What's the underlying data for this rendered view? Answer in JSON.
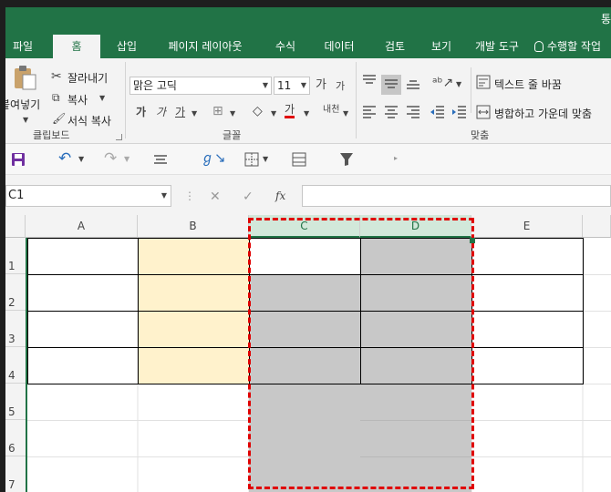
{
  "title": "통",
  "tabs": [
    "파일",
    "홈",
    "삽입",
    "페이지 레이아웃",
    "수식",
    "데이터",
    "검토",
    "보기",
    "개발 도구"
  ],
  "active_tab": "홈",
  "tell_me": "수행할 작업",
  "ribbon": {
    "clipboard": {
      "paste": "붙여넣기",
      "cut": "잘라내기",
      "copy": "복사",
      "format_painter": "서식 복사",
      "group": "클립보드"
    },
    "font": {
      "name": "맑은 고딕",
      "size": "11",
      "grow": "가",
      "shrink": "가",
      "bold": "가",
      "italic": "가",
      "underline": "가",
      "font_color_glyph": "가",
      "phonetic": "내천",
      "group": "글꼴"
    },
    "alignment": {
      "wrap_text": "텍스트 줄 바꿈",
      "merge_center": "병합하고 가운데 맞춤",
      "group": "맞춤"
    }
  },
  "name_box": "C1",
  "formula_icons": {
    "cancel": "✕",
    "enter": "✓",
    "fx": "fx"
  },
  "formula_value": "",
  "columns": [
    "A",
    "B",
    "C",
    "D",
    "E"
  ],
  "rows": [
    "1",
    "2",
    "3",
    "4",
    "5",
    "6",
    "7"
  ],
  "colors": {
    "accent": "#217346",
    "highlight_fill": "#fff2cc",
    "gray_fill": "#c8c8c8",
    "selection_border": "#e00000"
  }
}
